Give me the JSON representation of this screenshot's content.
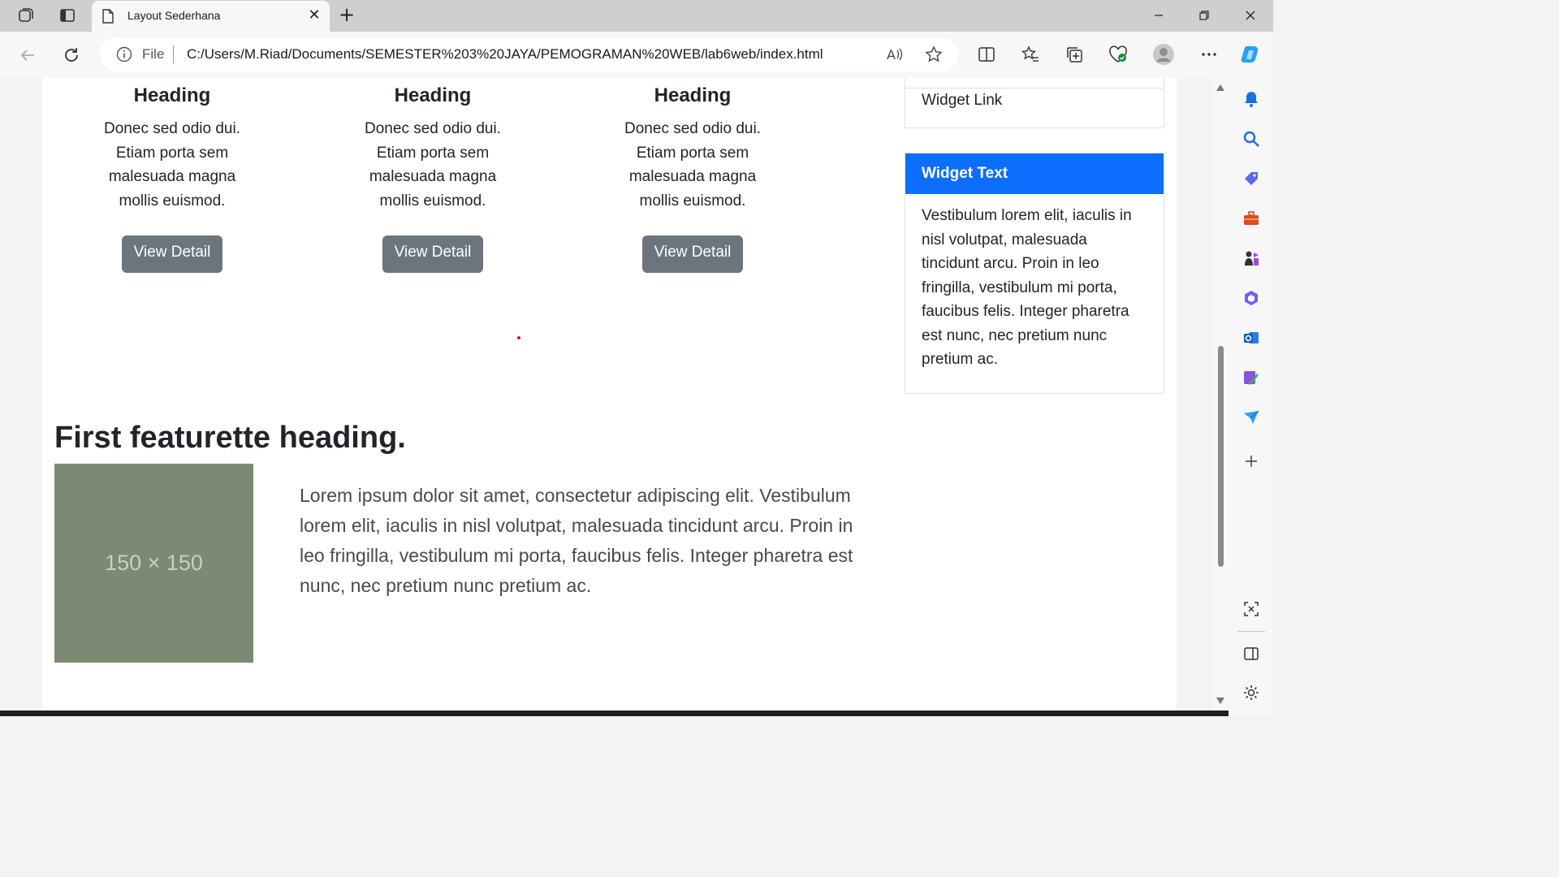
{
  "browser": {
    "tab_title": "Layout Sederhana",
    "tab_close": "✕",
    "new_tab": "+",
    "file_label": "File",
    "url": "C:/Users/M.Riad/Documents/SEMESTER%203%20JAYA/PEMOGRAMAN%20WEB/lab6web/index.html",
    "icons": [
      "workspaces-icon",
      "tab-actions-icon",
      "page-icon",
      "back-icon",
      "refresh-icon",
      "info-icon",
      "read-aloud-icon",
      "favorite-star-icon",
      "split-screen-icon",
      "favorites-icon",
      "collections-icon",
      "browser-essentials-icon",
      "profile-icon",
      "more-icon",
      "copilot-icon"
    ]
  },
  "sidebar": {
    "icons": [
      "bell-icon",
      "search-icon",
      "shopping-icon",
      "tools-icon",
      "games-icon",
      "microsoft-365-icon",
      "outlook-icon",
      "designer-icon",
      "send-icon",
      "add-icon",
      "screenshot-icon",
      "sidebar-toggle-icon",
      "settings-icon"
    ]
  },
  "page": {
    "columns": [
      {
        "heading": "Heading",
        "text": "Donec sed odio dui. Etiam porta sem malesuada magna mollis euismod.",
        "button": "View Detail"
      },
      {
        "heading": "Heading",
        "text": "Donec sed odio dui. Etiam porta sem malesuada magna mollis euismod.",
        "button": "View Detail"
      },
      {
        "heading": "Heading",
        "text": "Donec sed odio dui. Etiam porta sem malesuada magna mollis euismod.",
        "button": "View Detail"
      }
    ],
    "featurette": {
      "heading": "First featurette heading.",
      "image_label": "150 × 150",
      "text": "Lorem ipsum dolor sit amet, consectetur adipiscing elit. Vestibulum lorem elit, iaculis in nisl volutpat, malesuada tincidunt arcu. Proin in leo fringilla, vestibulum mi porta, faucibus felis. Integer pharetra est nunc, nec pretium nunc pretium ac."
    },
    "widgets": {
      "link_label": "Widget Link",
      "text_title": "Widget Text",
      "text_body": "Vestibulum lorem elit, iaculis in nisl volutpat, malesuada tincidunt arcu. Proin in leo fringilla, vestibulum mi porta, faucibus felis. Integer pharetra est nunc, nec pretium nunc pretium ac."
    }
  },
  "colors": {
    "primary": "#0d6efd",
    "secondary_button": "#6c757d",
    "placeholder_image": "#7d8a73"
  }
}
